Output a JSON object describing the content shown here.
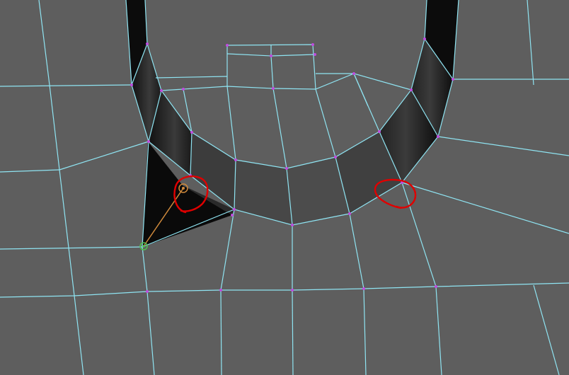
{
  "viewport": {
    "name": "3d-modeling-viewport",
    "mode": "polygon-mesh-edit",
    "colors": {
      "background": "#5d5d5d",
      "face": "#5e5e5e",
      "face_alt": "#606060",
      "hole_dark": "#0b0b0b",
      "wire": "#8fe4f2",
      "vertex": "#c04de0",
      "tool_line": "#d08a3c",
      "tool_handle": "#d08a3c",
      "tool_anchor": "#4fc04f",
      "annotation": "#e00000"
    }
  },
  "annotations": [
    {
      "name": "red-circle-annotation-left"
    },
    {
      "name": "red-circle-annotation-right"
    }
  ],
  "tool": {
    "name": "target-weld-tool",
    "description_icon": "target-weld-icon"
  }
}
